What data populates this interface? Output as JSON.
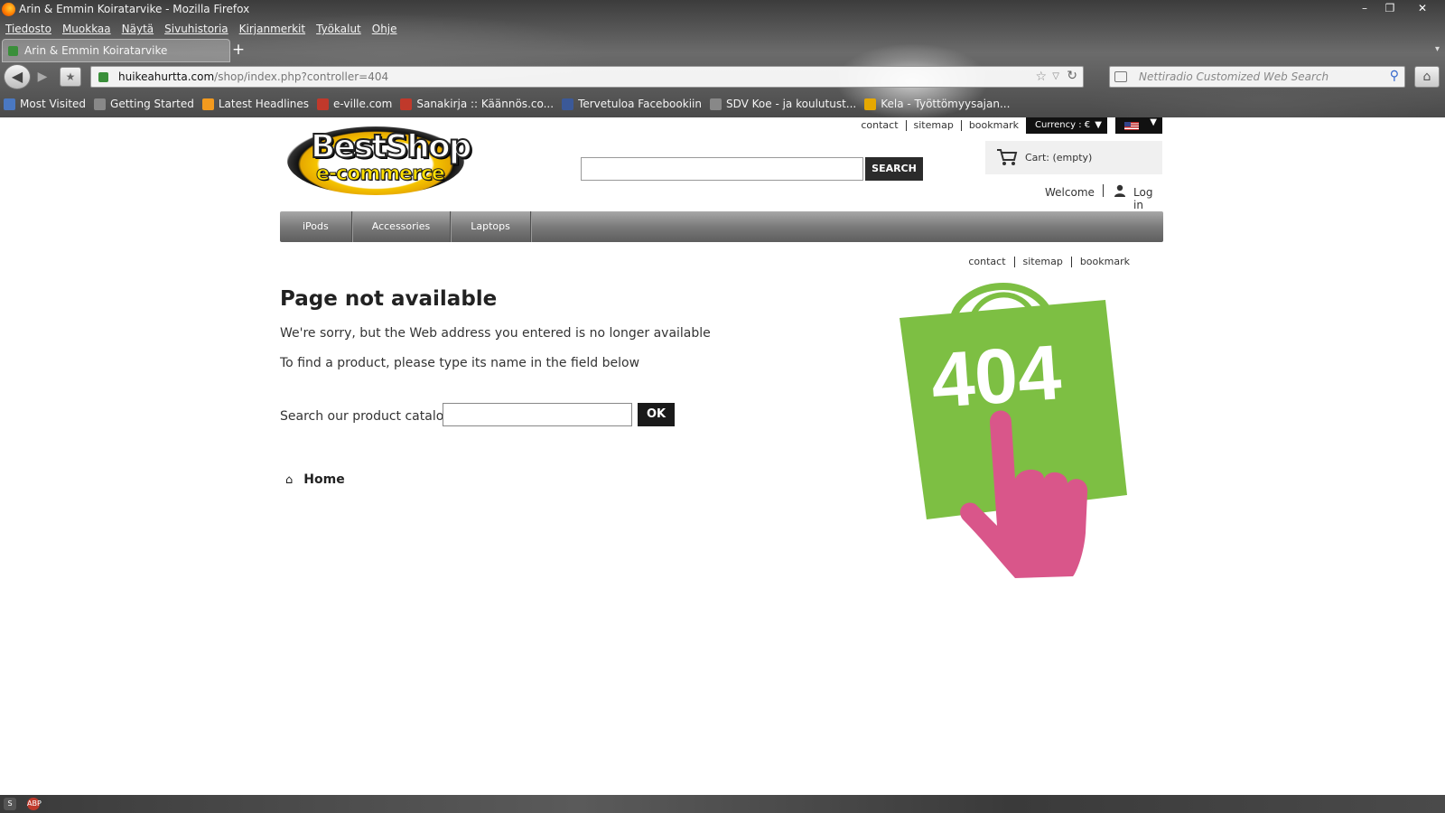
{
  "browser": {
    "window_title": "Arin & Emmin Koiratarvike - Mozilla Firefox",
    "window_controls": {
      "minimize": "–",
      "maximize": "❐",
      "close": "✕"
    },
    "menu": [
      "Tiedosto",
      "Muokkaa",
      "Näytä",
      "Sivuhistoria",
      "Kirjanmerkit",
      "Työkalut",
      "Ohje"
    ],
    "tab_title": "Arin & Emmin Koiratarvike",
    "new_tab_label": "+",
    "url_host": "huikeahurtta.com",
    "url_path": "/shop/index.php?controller=404",
    "search_placeholder": "Nettiradio Customized Web Search",
    "bookmarks": [
      {
        "label": "Most Visited",
        "icon": "bookmark-icon",
        "color": "#4a78c2"
      },
      {
        "label": "Getting Started",
        "icon": "page-icon",
        "color": "#888888"
      },
      {
        "label": "Latest Headlines",
        "icon": "rss-icon",
        "color": "#f39a1e"
      },
      {
        "label": "e-ville.com",
        "icon": "eville-icon",
        "color": "#c0392b"
      },
      {
        "label": "Sanakirja :: Käännös.co...",
        "icon": "k-icon",
        "color": "#c0392b"
      },
      {
        "label": "Tervetuloa Facebookiin",
        "icon": "facebook-icon",
        "color": "#3b5998"
      },
      {
        "label": "SDV Koe - ja koulutust...",
        "icon": "page-icon",
        "color": "#888888"
      },
      {
        "label": "Kela - Työttömyysajan...",
        "icon": "kela-icon",
        "color": "#e6a800"
      }
    ]
  },
  "shop": {
    "logo": {
      "line1": "BestShop",
      "line2": "e-commerce"
    },
    "top_links": [
      "contact",
      "sitemap",
      "bookmark"
    ],
    "currency_label": "Currency : €",
    "search_button": "SEARCH",
    "cart_label": "Cart: (empty)",
    "welcome": "Welcome",
    "login": "Log in",
    "menu": [
      "iPods",
      "Accessories",
      "Laptops"
    ],
    "sub_links": [
      "contact",
      "sitemap",
      "bookmark"
    ]
  },
  "error": {
    "title": "Page not available",
    "message1": "We're sorry, but the Web address you entered is no longer available",
    "message2": "To find a product, please type its name in the field below",
    "catalog_label": "Search our product catalog:",
    "ok_button": "OK",
    "home_link": "Home",
    "art_code": "404"
  },
  "colors": {
    "bag_green": "#7dbf43",
    "hand_pink": "#d9568a",
    "menu_gray": "#7a7a7a",
    "button_dark": "#1a1a1a"
  }
}
